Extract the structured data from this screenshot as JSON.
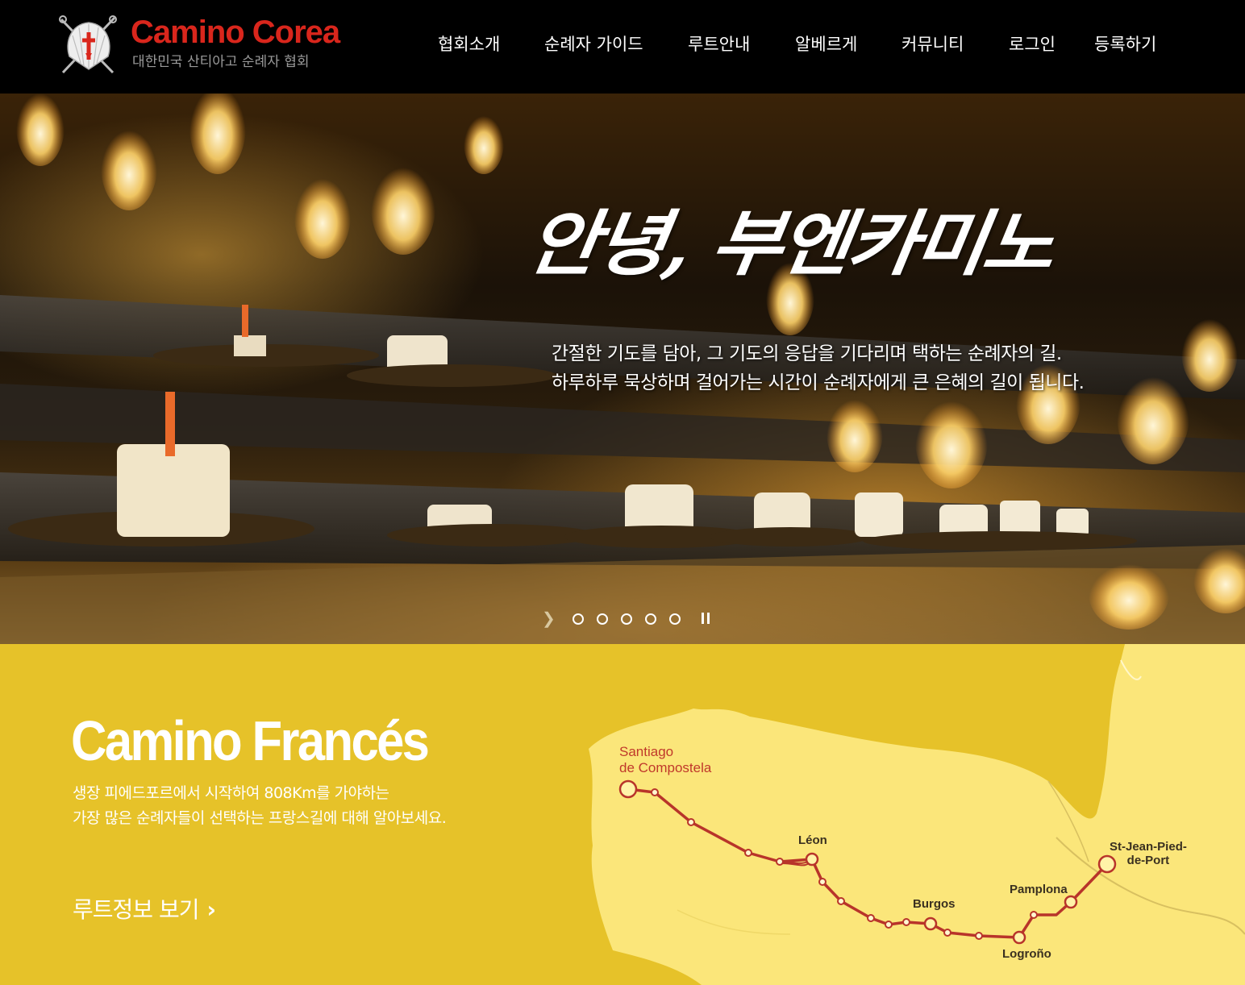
{
  "header": {
    "logo_title": "Camino Corea",
    "logo_subtitle": "대한민국 산티아고 순례자 협회",
    "nav": [
      "협회소개",
      "순례자 가이드",
      "루트안내",
      "알베르게",
      "커뮤니티",
      "로그인",
      "등록하기"
    ]
  },
  "hero": {
    "title": "안녕, 부엔카미노",
    "desc_line1": "간절한 기도를 담아, 그 기도의 응답을 기다리며 택하는 순례자의 길.",
    "desc_line2": "하루하루 묵상하며 걸어가는 시간이 순례자에게 큰 은혜의 길이 됩니다.",
    "slides": 5,
    "prev_icon": "chevron-right-icon",
    "pause_icon": "pause-icon"
  },
  "route": {
    "title": "Camino Francés",
    "desc_line1": "생장 피에드포르에서 시작하여 808Km를 가야하는",
    "desc_line2": "가장 많은 순례자들이 선택하는 프랑스길에 대해 알아보세요.",
    "link_label": "루트정보 보기",
    "map": {
      "start_line1": "Santiago",
      "start_line2": "de Compostela",
      "leon": "Léon",
      "burgos": "Burgos",
      "pamplona": "Pamplona",
      "logrono": "Logroño",
      "end_line1": "St-Jean-Pied-",
      "end_line2": "de-Port"
    }
  },
  "colors": {
    "header_bg": "#000000",
    "brand_red": "#d9261c",
    "route_bg": "#e6c229",
    "map_land": "#fbe67a",
    "route_line": "#b8342a"
  }
}
